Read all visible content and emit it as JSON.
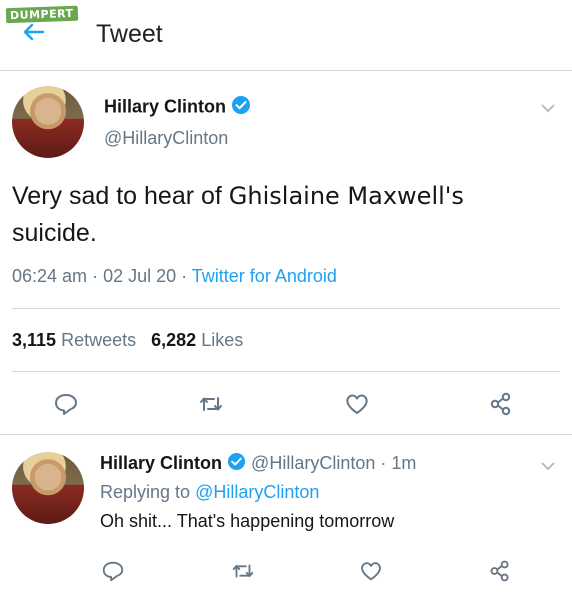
{
  "watermark": "DUMPERT",
  "header": {
    "title": "Tweet",
    "back_icon": "back-arrow-icon"
  },
  "tweet": {
    "name": "Hillary Clinton",
    "handle": "@HillaryClinton",
    "text_line1": "Very sad to hear of ",
    "text_inserted": "Ghislaine Maxwell's",
    "text_line2": "suicide.",
    "time": "06:24 am",
    "sep1": " · ",
    "date": "02 Jul 20",
    "sep2": " · ",
    "client": "Twitter for Android",
    "retweets_count": "3,115",
    "retweets_label": "Retweets",
    "likes_count": "6,282",
    "likes_label": "Likes"
  },
  "reply": {
    "name": "Hillary Clinton",
    "handle": "@HillaryClinton",
    "time": " · 1m",
    "replying_prefix": "Replying to ",
    "replying_to": "@HillaryClinton",
    "text": "Oh shit... That's happening tomorrow"
  },
  "colors": {
    "accent": "#1da1f2",
    "muted": "#657786",
    "divider": "#cfd4d8"
  }
}
